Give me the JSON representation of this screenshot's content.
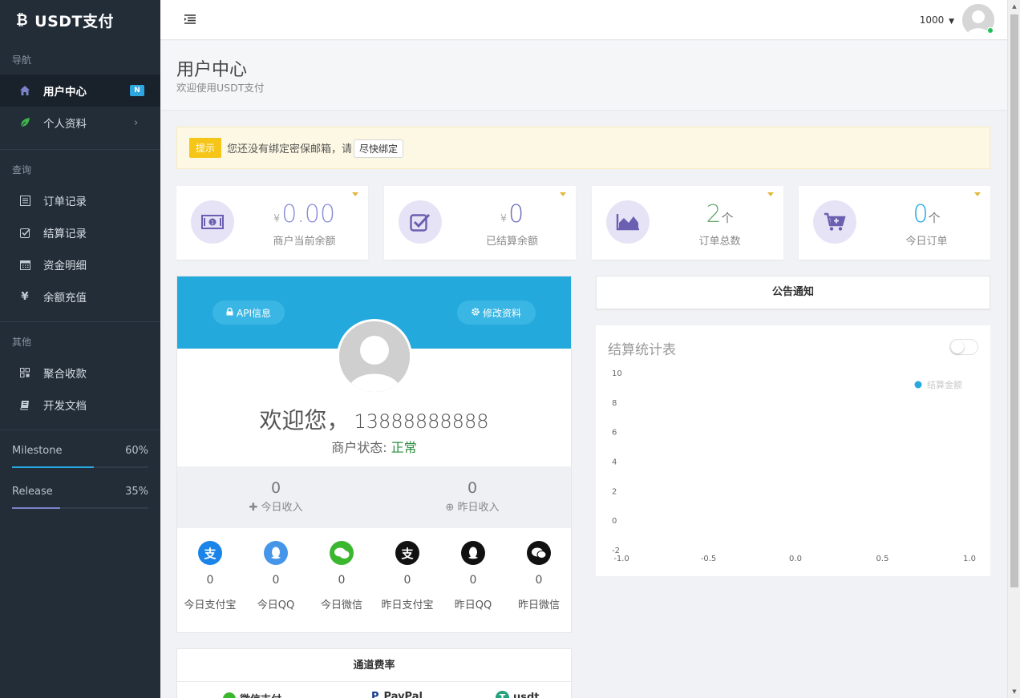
{
  "app": {
    "brand": "USDT支付"
  },
  "sidebar": {
    "sections": [
      {
        "label": "导航"
      },
      {
        "label": "查询"
      },
      {
        "label": "其他"
      }
    ],
    "items": [
      {
        "label": "用户中心",
        "icon": "home-icon",
        "badge": "N"
      },
      {
        "label": "个人资料",
        "icon": "leaf-icon"
      },
      {
        "label": "订单记录",
        "icon": "list-icon"
      },
      {
        "label": "结算记录",
        "icon": "check-square-icon"
      },
      {
        "label": "资金明细",
        "icon": "calendar-icon"
      },
      {
        "label": "余额充值",
        "icon": "yen-icon"
      },
      {
        "label": "聚合收款",
        "icon": "qrcode-icon"
      },
      {
        "label": "开发文档",
        "icon": "book-icon"
      }
    ],
    "progress": [
      {
        "label": "Milestone",
        "value_text": "60%",
        "value": 0.6,
        "color": "#26a8e0"
      },
      {
        "label": "Release",
        "value_text": "35%",
        "value": 0.35,
        "color": "#7c82c9"
      }
    ]
  },
  "topbar": {
    "user": "1000"
  },
  "header": {
    "title": "用户中心",
    "subtitle": "欢迎使用USDT支付"
  },
  "alert": {
    "tag": "提示",
    "text": "您还没有绑定密保邮箱，请",
    "button": "尽快绑定"
  },
  "stats": [
    {
      "prefix": "¥",
      "value": "0.00",
      "suffix": "",
      "label": "商户当前余额",
      "icon": "money-icon",
      "color": "#8b8fd6"
    },
    {
      "prefix": "¥",
      "value": "0",
      "suffix": "",
      "label": "已结算余额",
      "icon": "check-square-icon",
      "color": "#8b8fd6"
    },
    {
      "prefix": "",
      "value": "2",
      "suffix": "个",
      "label": "订单总数",
      "icon": "area-chart-icon",
      "color": "#6aa86f"
    },
    {
      "prefix": "",
      "value": "0",
      "suffix": "个",
      "label": "今日订单",
      "icon": "cart-plus-icon",
      "color": "#26a8e0"
    }
  ],
  "profile": {
    "api_button": "API信息",
    "edit_button": "修改资料",
    "welcome": "欢迎您，",
    "phone": "13888888888",
    "status_label": "商户状态:",
    "status_value": "正常",
    "today_income": {
      "value": "0",
      "label": "今日收入"
    },
    "yesterday_income": {
      "value": "0",
      "label": "昨日收入"
    },
    "payments": [
      {
        "value": "0",
        "label": "今日支付宝",
        "icon": "alipay-icon",
        "color": "#1a84e8"
      },
      {
        "value": "0",
        "label": "今日QQ",
        "icon": "qq-icon",
        "color": "#4596e8"
      },
      {
        "value": "0",
        "label": "今日微信",
        "icon": "wechat-icon",
        "color": "#3ab72f"
      },
      {
        "value": "0",
        "label": "昨日支付宝",
        "icon": "alipay-icon",
        "color": "#111111"
      },
      {
        "value": "0",
        "label": "昨日QQ",
        "icon": "qq-icon",
        "color": "#111111"
      },
      {
        "value": "0",
        "label": "昨日微信",
        "icon": "wechat-icon",
        "color": "#111111"
      }
    ]
  },
  "fees": {
    "title": "通道费率",
    "items": [
      {
        "label": "微信支付",
        "icon": "wechat-pay-icon",
        "color": "#3ab72f"
      },
      {
        "label": "PayPal",
        "icon": "paypal-icon",
        "color": "#173a8a"
      },
      {
        "label": "usdt",
        "icon": "tether-icon",
        "color": "#26a17b"
      }
    ]
  },
  "notice": {
    "title": "公告通知"
  },
  "chart": {
    "title": "结算统计表"
  },
  "chart_data": {
    "type": "line",
    "title": "结算统计表",
    "series": [
      {
        "name": "结算金额",
        "color": "#26a8e0",
        "x": [],
        "y": []
      }
    ],
    "xticks": [
      "-1.0",
      "-0.5",
      "0.0",
      "0.5",
      "1.0"
    ],
    "yticks": [
      "10",
      "8",
      "6",
      "4",
      "2",
      "0",
      "-2"
    ],
    "xlim": [
      -1.0,
      1.0
    ],
    "ylim": [
      -2,
      10
    ],
    "grid": false,
    "legend": "top-right"
  }
}
